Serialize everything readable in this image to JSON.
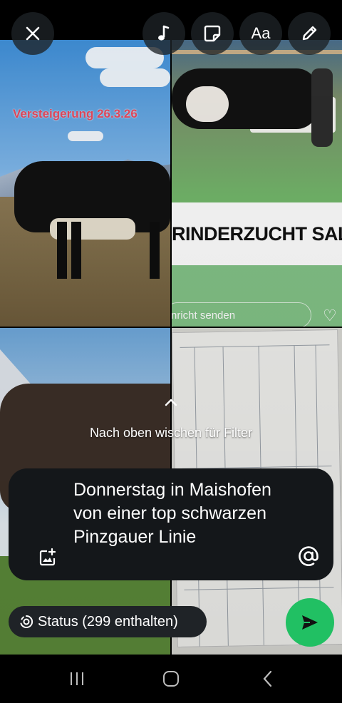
{
  "tiles": {
    "tile1_overlay": "Versteigerung 26.3.26",
    "tile2_banner": "RINDERZUCHT SALZBU",
    "tile2_reply": "nricht senden"
  },
  "hint": {
    "text": "Nach oben wischen für Filter"
  },
  "caption": {
    "text": "Donnerstag in Maishofen von einer top schwarzen Pinzgauer Linie"
  },
  "status": {
    "label": "Status (299 enthalten)"
  },
  "toolbar": {
    "text_tool": "Aa"
  },
  "icons": {
    "close": "close-icon",
    "music": "music-note-icon",
    "sticker": "sticker-icon",
    "pencil": "pencil-icon",
    "add_image": "add-image-icon",
    "mention": "at-icon",
    "send": "send-icon"
  },
  "colors": {
    "send_button": "#21c063",
    "caption_bg": "#14171a"
  }
}
